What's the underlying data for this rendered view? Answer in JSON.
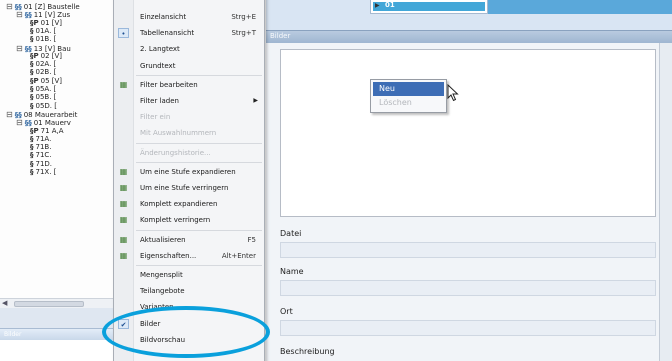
{
  "tree": {
    "rows": [
      {
        "indent": 6,
        "glyph": "⊟",
        "node": "§§",
        "text": "01 [Z] Baustelle"
      },
      {
        "indent": 16,
        "glyph": "⊟",
        "node": "§§",
        "text": "11 [V] Zus"
      },
      {
        "indent": 30,
        "glyph": "",
        "node": "§P",
        "text": "01 [V]"
      },
      {
        "indent": 30,
        "glyph": "",
        "node": "§",
        "text": "01A. [ "
      },
      {
        "indent": 30,
        "glyph": "",
        "node": "§",
        "text": "01B. [ "
      },
      {
        "indent": 16,
        "glyph": "⊟",
        "node": "§§",
        "text": "13 [V] Bau"
      },
      {
        "indent": 30,
        "glyph": "",
        "node": "§P",
        "text": "02 [V]"
      },
      {
        "indent": 30,
        "glyph": "",
        "node": "§",
        "text": "02A. ["
      },
      {
        "indent": 30,
        "glyph": "",
        "node": "§",
        "text": "02B. ["
      },
      {
        "indent": 30,
        "glyph": "",
        "node": "§P",
        "text": "05 [V]"
      },
      {
        "indent": 30,
        "glyph": "",
        "node": "§",
        "text": "05A. ["
      },
      {
        "indent": 30,
        "glyph": "",
        "node": "§",
        "text": "05B. ["
      },
      {
        "indent": 30,
        "glyph": "",
        "node": "§",
        "text": "05D. ["
      },
      {
        "indent": 6,
        "glyph": "⊟",
        "node": "§§",
        "text": "08 Mauerarbeit"
      },
      {
        "indent": 16,
        "glyph": "⊟",
        "node": "§§",
        "text": "01 Mauerv"
      },
      {
        "indent": 30,
        "glyph": "",
        "node": "§P",
        "text": "71 A,A"
      },
      {
        "indent": 30,
        "glyph": "",
        "node": "§",
        "text": "71A. "
      },
      {
        "indent": 30,
        "glyph": "",
        "node": "§",
        "text": "71B. "
      },
      {
        "indent": 30,
        "glyph": "",
        "node": "§",
        "text": "71C. "
      },
      {
        "indent": 30,
        "glyph": "",
        "node": "§",
        "text": "71D. "
      },
      {
        "indent": 30,
        "glyph": "",
        "node": "§",
        "text": "71X. ["
      }
    ],
    "bottom_panel_title": "Bilder"
  },
  "context_menu": {
    "items": [
      {
        "label": "Einzelansicht",
        "shortcut": "Strg+E",
        "top": 0
      },
      {
        "label": "Tabellenansicht",
        "shortcut": "Strg+T",
        "checked": true
      },
      {
        "label": "2. Langtext"
      },
      {
        "label": "Grundtext"
      },
      {
        "sep": true
      },
      {
        "label": "Filter bearbeiten",
        "icon": true
      },
      {
        "label": "Filter laden",
        "submenu": true
      },
      {
        "label": "Filter ein",
        "disabled": true
      },
      {
        "label": "Mit Auswahlnummern",
        "disabled": true
      },
      {
        "sep": true
      },
      {
        "label": "Änderungshistorie...",
        "disabled": true
      },
      {
        "sep": true
      },
      {
        "label": "Um eine Stufe expandieren",
        "icon": true
      },
      {
        "label": "Um eine Stufe verringern",
        "icon": true
      },
      {
        "label": "Komplett expandieren",
        "icon": true
      },
      {
        "label": "Komplett verringern",
        "icon": true
      },
      {
        "sep": true
      },
      {
        "label": "Aktualisieren",
        "shortcut": "F5",
        "icon": true
      },
      {
        "label": "Eigenschaften...",
        "shortcut": "Alt+Enter",
        "icon": true
      },
      {
        "sep": true
      },
      {
        "label": "Mengensplit"
      },
      {
        "label": "Teilangebote"
      },
      {
        "label": "Varianten"
      },
      {
        "label": "Bilder",
        "checked": true
      },
      {
        "label": "Bildvorschau"
      }
    ]
  },
  "right_tree": {
    "selected_item": "01"
  },
  "bilder_panel": {
    "title": "Bilder",
    "popup": {
      "items": [
        {
          "label": "Neu",
          "hover": true
        },
        {
          "label": "Löschen",
          "disabled": true
        }
      ]
    },
    "fields": [
      {
        "label": "Datei"
      },
      {
        "label": "Name"
      },
      {
        "label": "Ort"
      },
      {
        "label": "Beschreibung"
      }
    ]
  },
  "colors": {
    "highlight_ellipse": "#0aa0dc",
    "menu_hover": "#3d6db5"
  }
}
